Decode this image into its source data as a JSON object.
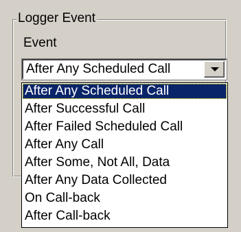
{
  "group": {
    "title": "Logger Event"
  },
  "event": {
    "label": "Event",
    "selected_value": "After Any Scheduled Call",
    "options": [
      "After Any Scheduled Call",
      "After Successful Call",
      "After Failed Scheduled Call",
      "After Any Call",
      "After Some, Not All, Data",
      "After Any Data Collected",
      "On Call-back",
      "After Call-back"
    ],
    "highlighted_option": "After Any Scheduled Call"
  },
  "icons": {
    "dropdown_button": "chevron-down-icon"
  },
  "colors": {
    "window_background": "#d4d0c8",
    "selection_background": "#0a246a",
    "selection_text": "#ffffff",
    "list_background": "#ffffff"
  }
}
